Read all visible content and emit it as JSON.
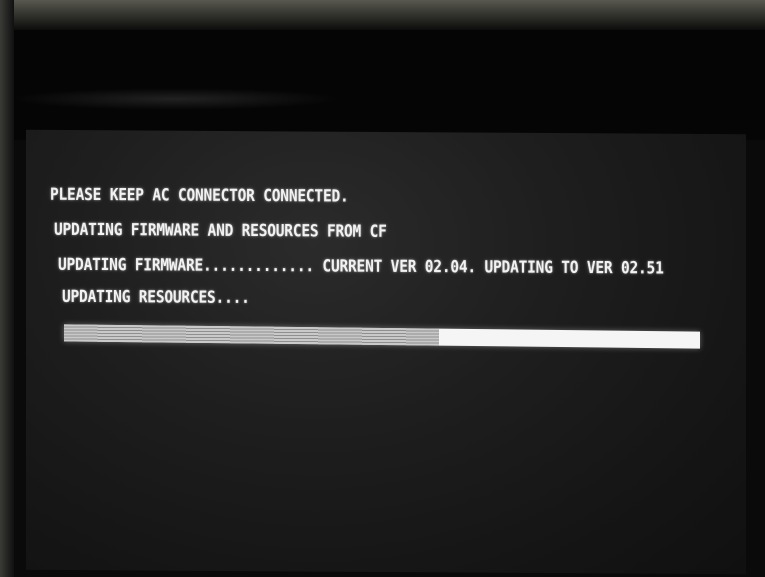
{
  "screen": {
    "lines": {
      "keep_connected": "PLEASE KEEP AC CONNECTOR CONNECTED.",
      "updating_from": "UPDATING FIRMWARE AND RESOURCES FROM CF",
      "updating_firmware": "UPDATING FIRMWARE............. CURRENT VER 02.04. UPDATING TO VER 02.51",
      "updating_resources": "UPDATING RESOURCES...."
    },
    "progress": {
      "fraction": 0.59
    },
    "colors": {
      "text": "#f2f2f2",
      "background": "#1e1e1e",
      "progress_track": "#f5f5f5",
      "progress_fill": "#a9a9a9"
    }
  }
}
